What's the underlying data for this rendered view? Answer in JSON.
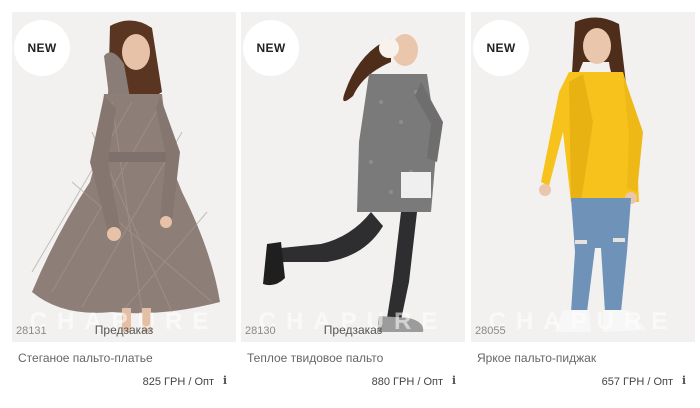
{
  "products": [
    {
      "badge": "NEW",
      "sku": "28131",
      "status": "Предзаказ",
      "title": "Стеганое пальто-платье",
      "price": "825 ГРН / Опт",
      "info": "i"
    },
    {
      "badge": "NEW",
      "sku": "28130",
      "status": "Предзаказ",
      "title": "Теплое твидовое пальто",
      "price": "880 ГРН / Опт",
      "info": "i"
    },
    {
      "badge": "NEW",
      "sku": "28055",
      "status": "",
      "title": "Яркое пальто-пиджак",
      "price": "657 ГРН / Опт",
      "info": "i"
    }
  ],
  "colors": {
    "quilted_coat": "#8d7f78",
    "tweed_coat": "#7a7a7a",
    "yellow_coat": "#f6c21b",
    "jeans": "#6f93b8"
  }
}
